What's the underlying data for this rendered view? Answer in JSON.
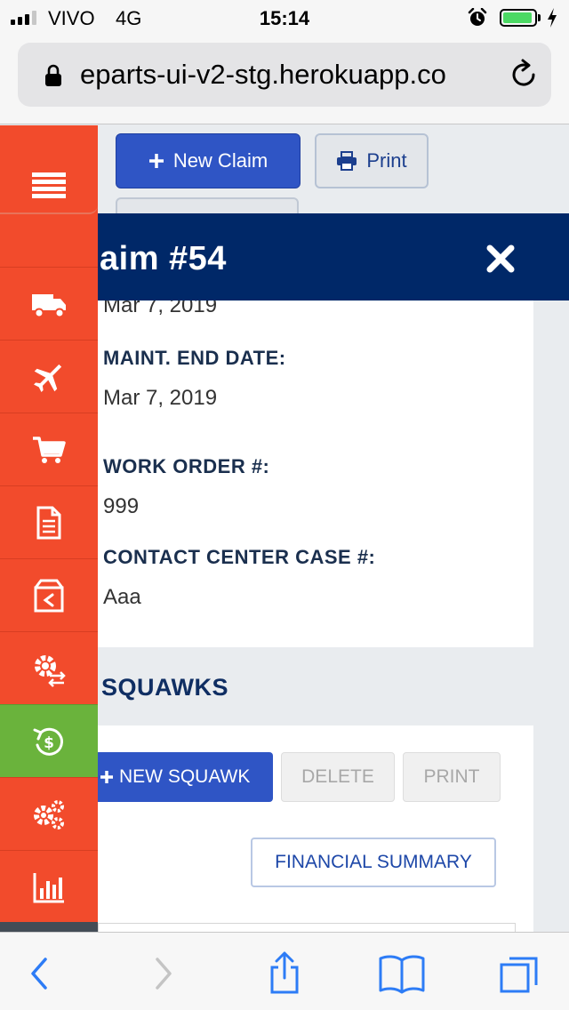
{
  "status_bar": {
    "carrier": "VIVO",
    "network": "4G",
    "time": "15:14",
    "battery_level_pct": 95,
    "icons": [
      "signal-icon",
      "alarm-icon",
      "battery-icon",
      "charging-icon"
    ]
  },
  "browser": {
    "url": "eparts-ui-v2-stg.herokuapp.co",
    "icons": [
      "lock-icon",
      "reload-icon"
    ]
  },
  "toolbar": {
    "new_claim_label": "New Claim",
    "print_label": "Print"
  },
  "modal": {
    "title": "aim #54",
    "partial_date": "Mar 7, 2019",
    "fields": [
      {
        "label": "MAINT. END DATE:",
        "value": "Mar 7, 2019"
      },
      {
        "label": "WORK ORDER #:",
        "value": "999"
      },
      {
        "label": "CONTACT CENTER CASE #:",
        "value": "Aaa"
      }
    ],
    "squawks": {
      "title": "SQUAWKS",
      "new_label": "NEW SQUAWK",
      "delete_label": "DELETE",
      "print_label": "PRINT",
      "financial_label": "FINANCIAL SUMMARY"
    }
  },
  "sidebar": {
    "items": [
      {
        "icon": "truck-icon"
      },
      {
        "icon": "airplane-icon"
      },
      {
        "icon": "cart-icon"
      },
      {
        "icon": "document-icon"
      },
      {
        "icon": "return-box-icon"
      },
      {
        "icon": "gear-exchange-icon"
      },
      {
        "icon": "dollar-refresh-icon",
        "active": true
      },
      {
        "icon": "gears-icon"
      },
      {
        "icon": "bar-chart-icon"
      }
    ]
  },
  "colors": {
    "sidebar": "#f24b2c",
    "sidebar_active": "#6ab33c",
    "modal_header": "#002868",
    "primary_button": "#2f55c5",
    "ios_blue": "#2d7cf6"
  }
}
